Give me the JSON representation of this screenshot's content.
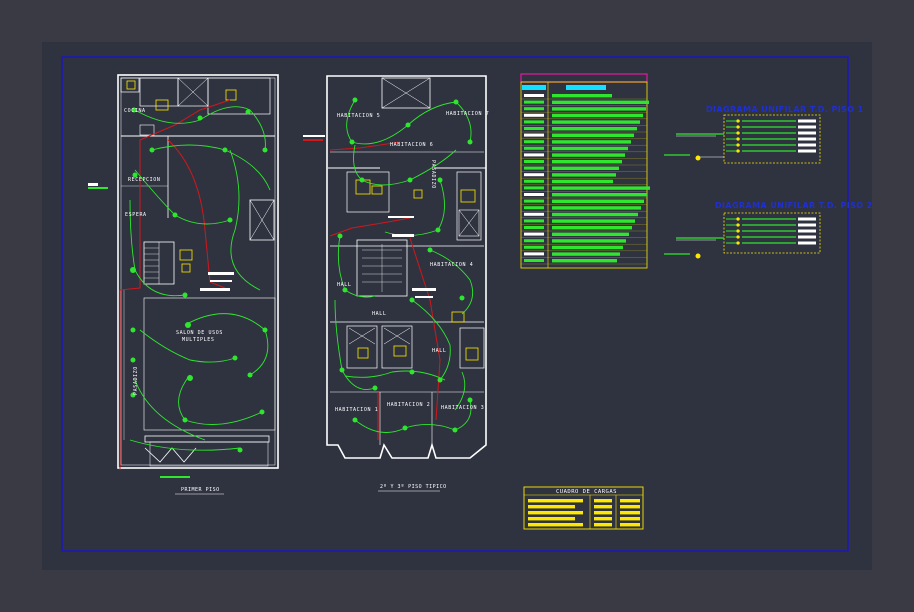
{
  "colors": {
    "background": "#3a3a45",
    "paper": "#2f3340",
    "frame": "#1a16c8",
    "walls": "#ffffff",
    "circuits": "#2ee62e",
    "feed": "#d0181c",
    "accent": "#ffe800",
    "legend_header": "#e01aa0",
    "legend_cyan": "#12e0ff",
    "diagram_title": "#1f2fd0"
  },
  "plan1": {
    "rooms": {
      "cocina": "COCINA",
      "recepcion": "RECEPCION",
      "espera": "ESPERA",
      "salon_l1": "SALON DE USOS",
      "salon_l2": "MULTIPLES",
      "pasadizo": "PASADIZO"
    },
    "title": "PRIMER PISO"
  },
  "plan2": {
    "rooms": {
      "hab5": "HABITACION 5",
      "hab7": "HABITACION 7",
      "hab6": "HABITACION 6",
      "hab4": "HABITACION 4",
      "hab1": "HABITACION 1",
      "hab2": "HABITACION 2",
      "hab3": "HABITACION 3",
      "hall_a": "HALL",
      "hall_b": "HALL",
      "hall_c": "HALL",
      "pasadizo": "PASADIZO"
    },
    "title": "2º Y 3º PISO TIPICO"
  },
  "diagrams": {
    "d1_title": "DIAGRAMA UNIFILAR T.D. PISO 1",
    "d2_title": "DIAGRAMA UNIFILAR T.D. PISO 2"
  },
  "cuadro": {
    "title": "CUADRO DE CARGAS"
  }
}
